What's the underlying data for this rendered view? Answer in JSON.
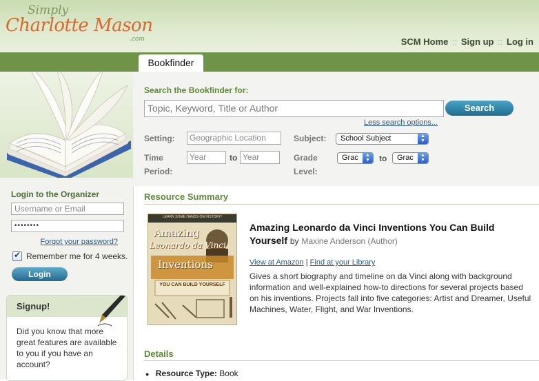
{
  "logo": {
    "simply": "Simply",
    "name": "Charlotte Mason",
    "domain": ".com"
  },
  "topnav": {
    "home": "SCM Home",
    "signup": "Sign up",
    "login": "Log in",
    "separator": "::"
  },
  "tab": {
    "label": "Bookfinder"
  },
  "search": {
    "heading": "Search the Bookfinder for:",
    "placeholder": "Topic, Keyword, Title or Author",
    "button": "Search",
    "less_options": "Less search options...",
    "setting_label": "Setting:",
    "setting_placeholder": "Geographic Location",
    "time_label_1": "Time",
    "time_label_2": "Period:",
    "year_from": "Year",
    "to": "to",
    "year_to": "Year",
    "subject_label": "Subject:",
    "subject_value": "School Subject",
    "grade_label_1": "Grade",
    "grade_label_2": "Level:",
    "grade_from": "Grac",
    "grade_to": "Grac"
  },
  "sidebar": {
    "login_title": "Login to the Organizer",
    "username_placeholder": "Username or Email",
    "password_value": "••••••••",
    "forgot": "Forgot your password?",
    "remember": "Remember me for 4 weeks.",
    "login_button": "Login",
    "signup_title": "Signup!",
    "signup_text": "Did you know that more great features are available to you if you have an account?"
  },
  "resource": {
    "section_title": "Resource Summary",
    "title": "Amazing Leonardo da Vinci Inventions You Can Build Yourself",
    "by": "by",
    "author": "Maxine Anderson (Author)",
    "view_amazon": "View at Amazon",
    "link_sep": "|",
    "find_library": "Find at your Library",
    "description": "Gives a short biography and timeline on da Vinci along with background information and well-explained how-to directions for several projects based on his inventions. Projects fall into five categories: Artist and Dreamer, Useful Machines, Water, Flight, and War Inventions.",
    "cover": {
      "top_text": "LEARN SOME HANDS-ON HISTORY!",
      "amazing": "Amazing",
      "leonardo": "Leonardo da Vinci",
      "inventions": "Inventions",
      "subtitle": "YOU CAN BUILD YOURSELF"
    }
  },
  "details": {
    "section_title": "Details",
    "type_label": "Resource Type:",
    "type_value": "Book"
  }
}
